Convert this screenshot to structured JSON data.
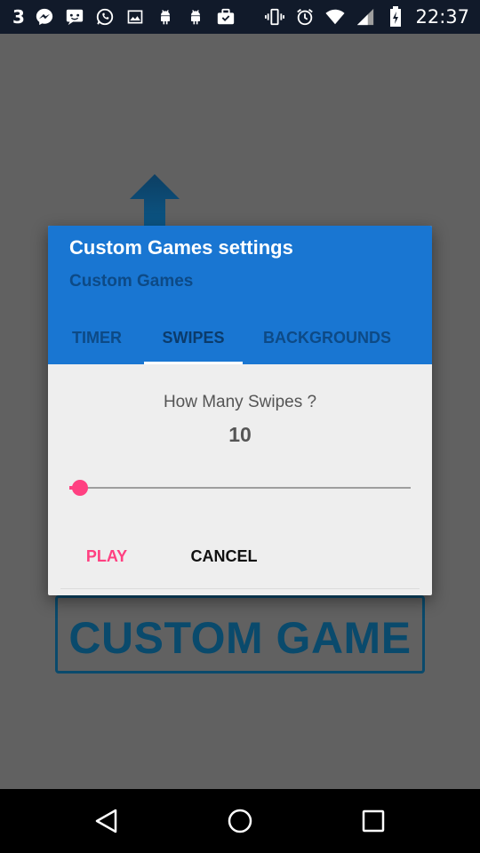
{
  "status_bar": {
    "notification_count": "3",
    "time": "22:37",
    "left_icons": [
      "messenger-icon",
      "chat-icon",
      "whatsapp-icon",
      "gallery-icon",
      "android-icon",
      "android-icon",
      "briefcase-icon"
    ],
    "right_icons": [
      "vibrate-icon",
      "alarm-icon",
      "wifi-icon",
      "signal-icon",
      "battery-icon"
    ]
  },
  "background": {
    "custom_game_label": "CUSTOM GAME",
    "arrow_icon": "up-arrow-icon"
  },
  "dialog": {
    "title": "Custom Games settings",
    "subtitle": "Custom Games",
    "tabs": [
      {
        "label": "TIMER",
        "selected": false
      },
      {
        "label": "SWIPES",
        "selected": true
      },
      {
        "label": "BACKGROUNDS",
        "selected": false
      }
    ],
    "question": "How Many Swipes ?",
    "value": "10",
    "slider_fraction": 0.03,
    "buttons": {
      "play": "PLAY",
      "cancel": "CANCEL"
    }
  },
  "colors": {
    "header": "#1976d2",
    "accent": "#ff4081",
    "scrim": "#616161"
  },
  "nav_bar": {
    "icons": [
      "back-icon",
      "home-icon",
      "recents-icon"
    ]
  }
}
